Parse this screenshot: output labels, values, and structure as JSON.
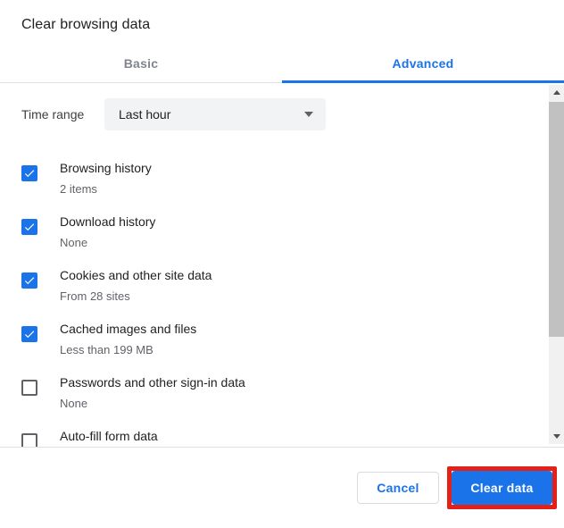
{
  "dialog": {
    "title": "Clear browsing data"
  },
  "tabs": [
    {
      "label": "Basic",
      "active": false
    },
    {
      "label": "Advanced",
      "active": true
    }
  ],
  "time_range": {
    "label": "Time range",
    "value": "Last hour"
  },
  "items": [
    {
      "label": "Browsing history",
      "detail": "2 items",
      "checked": true
    },
    {
      "label": "Download history",
      "detail": "None",
      "checked": true
    },
    {
      "label": "Cookies and other site data",
      "detail": "From 28 sites",
      "checked": true
    },
    {
      "label": "Cached images and files",
      "detail": "Less than 199 MB",
      "checked": true
    },
    {
      "label": "Passwords and other sign-in data",
      "detail": "None",
      "checked": false
    },
    {
      "label": "Auto-fill form data",
      "detail": "",
      "checked": false
    }
  ],
  "footer": {
    "cancel_label": "Cancel",
    "clear_label": "Clear data"
  },
  "colors": {
    "accent_blue": "#1a73e8",
    "highlight_red": "#e32119",
    "label_dark": "#202124",
    "label_gray": "#5f6368",
    "dropdown_bg": "#f1f3f4"
  }
}
